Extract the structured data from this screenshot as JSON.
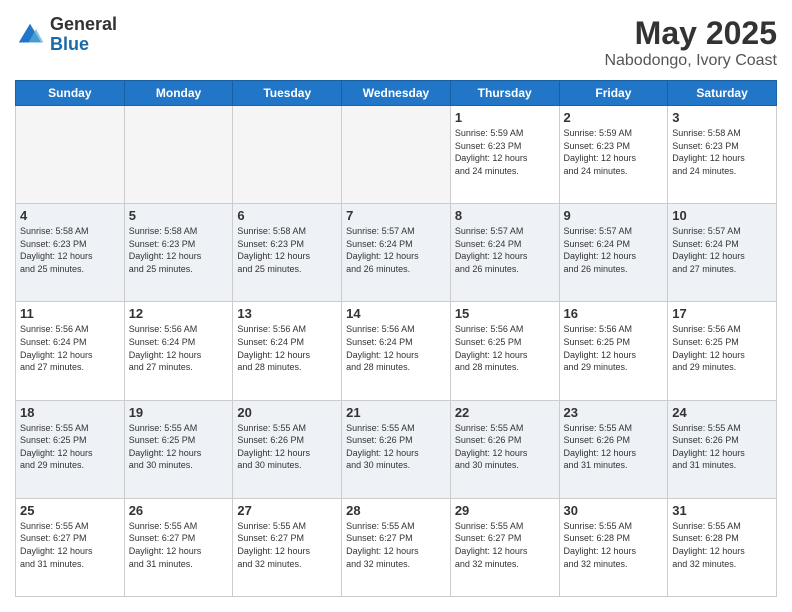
{
  "header": {
    "logo_general": "General",
    "logo_blue": "Blue",
    "main_title": "May 2025",
    "subtitle": "Nabodongo, Ivory Coast"
  },
  "calendar": {
    "days_of_week": [
      "Sunday",
      "Monday",
      "Tuesday",
      "Wednesday",
      "Thursday",
      "Friday",
      "Saturday"
    ],
    "weeks": [
      [
        {
          "day": "",
          "info": ""
        },
        {
          "day": "",
          "info": ""
        },
        {
          "day": "",
          "info": ""
        },
        {
          "day": "",
          "info": ""
        },
        {
          "day": "1",
          "info": "Sunrise: 5:59 AM\nSunset: 6:23 PM\nDaylight: 12 hours\nand 24 minutes."
        },
        {
          "day": "2",
          "info": "Sunrise: 5:59 AM\nSunset: 6:23 PM\nDaylight: 12 hours\nand 24 minutes."
        },
        {
          "day": "3",
          "info": "Sunrise: 5:58 AM\nSunset: 6:23 PM\nDaylight: 12 hours\nand 24 minutes."
        }
      ],
      [
        {
          "day": "4",
          "info": "Sunrise: 5:58 AM\nSunset: 6:23 PM\nDaylight: 12 hours\nand 25 minutes."
        },
        {
          "day": "5",
          "info": "Sunrise: 5:58 AM\nSunset: 6:23 PM\nDaylight: 12 hours\nand 25 minutes."
        },
        {
          "day": "6",
          "info": "Sunrise: 5:58 AM\nSunset: 6:23 PM\nDaylight: 12 hours\nand 25 minutes."
        },
        {
          "day": "7",
          "info": "Sunrise: 5:57 AM\nSunset: 6:24 PM\nDaylight: 12 hours\nand 26 minutes."
        },
        {
          "day": "8",
          "info": "Sunrise: 5:57 AM\nSunset: 6:24 PM\nDaylight: 12 hours\nand 26 minutes."
        },
        {
          "day": "9",
          "info": "Sunrise: 5:57 AM\nSunset: 6:24 PM\nDaylight: 12 hours\nand 26 minutes."
        },
        {
          "day": "10",
          "info": "Sunrise: 5:57 AM\nSunset: 6:24 PM\nDaylight: 12 hours\nand 27 minutes."
        }
      ],
      [
        {
          "day": "11",
          "info": "Sunrise: 5:56 AM\nSunset: 6:24 PM\nDaylight: 12 hours\nand 27 minutes."
        },
        {
          "day": "12",
          "info": "Sunrise: 5:56 AM\nSunset: 6:24 PM\nDaylight: 12 hours\nand 27 minutes."
        },
        {
          "day": "13",
          "info": "Sunrise: 5:56 AM\nSunset: 6:24 PM\nDaylight: 12 hours\nand 28 minutes."
        },
        {
          "day": "14",
          "info": "Sunrise: 5:56 AM\nSunset: 6:24 PM\nDaylight: 12 hours\nand 28 minutes."
        },
        {
          "day": "15",
          "info": "Sunrise: 5:56 AM\nSunset: 6:25 PM\nDaylight: 12 hours\nand 28 minutes."
        },
        {
          "day": "16",
          "info": "Sunrise: 5:56 AM\nSunset: 6:25 PM\nDaylight: 12 hours\nand 29 minutes."
        },
        {
          "day": "17",
          "info": "Sunrise: 5:56 AM\nSunset: 6:25 PM\nDaylight: 12 hours\nand 29 minutes."
        }
      ],
      [
        {
          "day": "18",
          "info": "Sunrise: 5:55 AM\nSunset: 6:25 PM\nDaylight: 12 hours\nand 29 minutes."
        },
        {
          "day": "19",
          "info": "Sunrise: 5:55 AM\nSunset: 6:25 PM\nDaylight: 12 hours\nand 30 minutes."
        },
        {
          "day": "20",
          "info": "Sunrise: 5:55 AM\nSunset: 6:26 PM\nDaylight: 12 hours\nand 30 minutes."
        },
        {
          "day": "21",
          "info": "Sunrise: 5:55 AM\nSunset: 6:26 PM\nDaylight: 12 hours\nand 30 minutes."
        },
        {
          "day": "22",
          "info": "Sunrise: 5:55 AM\nSunset: 6:26 PM\nDaylight: 12 hours\nand 30 minutes."
        },
        {
          "day": "23",
          "info": "Sunrise: 5:55 AM\nSunset: 6:26 PM\nDaylight: 12 hours\nand 31 minutes."
        },
        {
          "day": "24",
          "info": "Sunrise: 5:55 AM\nSunset: 6:26 PM\nDaylight: 12 hours\nand 31 minutes."
        }
      ],
      [
        {
          "day": "25",
          "info": "Sunrise: 5:55 AM\nSunset: 6:27 PM\nDaylight: 12 hours\nand 31 minutes."
        },
        {
          "day": "26",
          "info": "Sunrise: 5:55 AM\nSunset: 6:27 PM\nDaylight: 12 hours\nand 31 minutes."
        },
        {
          "day": "27",
          "info": "Sunrise: 5:55 AM\nSunset: 6:27 PM\nDaylight: 12 hours\nand 32 minutes."
        },
        {
          "day": "28",
          "info": "Sunrise: 5:55 AM\nSunset: 6:27 PM\nDaylight: 12 hours\nand 32 minutes."
        },
        {
          "day": "29",
          "info": "Sunrise: 5:55 AM\nSunset: 6:27 PM\nDaylight: 12 hours\nand 32 minutes."
        },
        {
          "day": "30",
          "info": "Sunrise: 5:55 AM\nSunset: 6:28 PM\nDaylight: 12 hours\nand 32 minutes."
        },
        {
          "day": "31",
          "info": "Sunrise: 5:55 AM\nSunset: 6:28 PM\nDaylight: 12 hours\nand 32 minutes."
        }
      ]
    ]
  }
}
